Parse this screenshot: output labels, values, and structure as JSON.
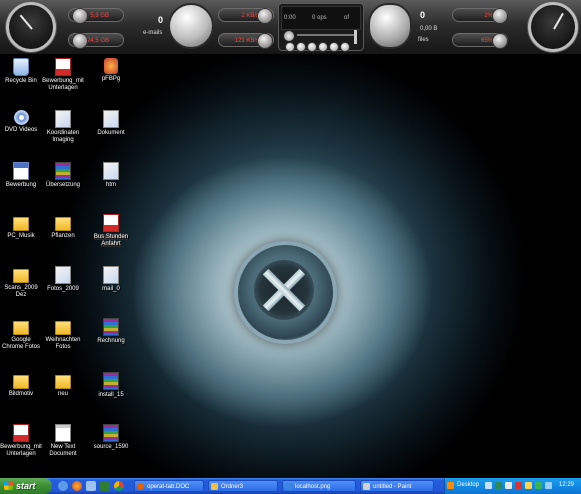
{
  "topbar": {
    "disk_c": "5,3 GB",
    "disk_d": "24,5 GB",
    "mail_count": "0",
    "mail_label": "e-mails",
    "net_down": "2 KB/s",
    "net_up": "121 KB/s",
    "player_time": "0:00",
    "player_track": "0 ops",
    "player_of": "of",
    "recycle_count": "0",
    "recycle_size": "0,00 B",
    "recycle_label": "files",
    "cpu": "2%",
    "ram": "65%"
  },
  "desktop": {
    "icons": [
      {
        "label": "Recycle Bin",
        "type": "recycle"
      },
      {
        "label": "Bewerbung_mit Unterlagen",
        "type": "pdf"
      },
      {
        "label": "pFBPg",
        "type": "app"
      },
      {
        "label": "DVD Videos",
        "type": "dvd"
      },
      {
        "label": "Koordinaten Imaging",
        "type": "img"
      },
      {
        "label": "Dokument",
        "type": "img"
      },
      {
        "label": "Bewerbung",
        "type": "docx"
      },
      {
        "label": "Übersetzung",
        "type": "rar"
      },
      {
        "label": "htm",
        "type": "img"
      },
      {
        "label": "PC_Musik",
        "type": "folder"
      },
      {
        "label": "Pflanzen",
        "type": "folder"
      },
      {
        "label": "Bus Stunden Anfahrt",
        "type": "pdf"
      },
      {
        "label": "Scans_2009 Dez",
        "type": "folder"
      },
      {
        "label": "Fotos_2009",
        "type": "img"
      },
      {
        "label": "mail_0",
        "type": "img"
      },
      {
        "label": "Google Chrome Fotos",
        "type": "folder"
      },
      {
        "label": "Weihnachten Fotos",
        "type": "folder"
      },
      {
        "label": "Rechnung",
        "type": "rar"
      },
      {
        "label": "Bildmotiv",
        "type": "folder"
      },
      {
        "label": "neu",
        "type": "folder"
      },
      {
        "label": "install_15",
        "type": "rar"
      },
      {
        "label": "Bewerbung_mit Unterlagen",
        "type": "pdf"
      },
      {
        "label": "New Text Document",
        "type": "txt"
      },
      {
        "label": "source_1590",
        "type": "rar"
      }
    ]
  },
  "taskbar": {
    "start_label": "start",
    "tasks": [
      {
        "label": "operat-tab.DOC"
      },
      {
        "label": "Ordner3"
      },
      {
        "label": "localhost.png"
      },
      {
        "label": "untitled - Paint"
      }
    ],
    "tray_label": "Desktop",
    "clock": "12:29"
  }
}
